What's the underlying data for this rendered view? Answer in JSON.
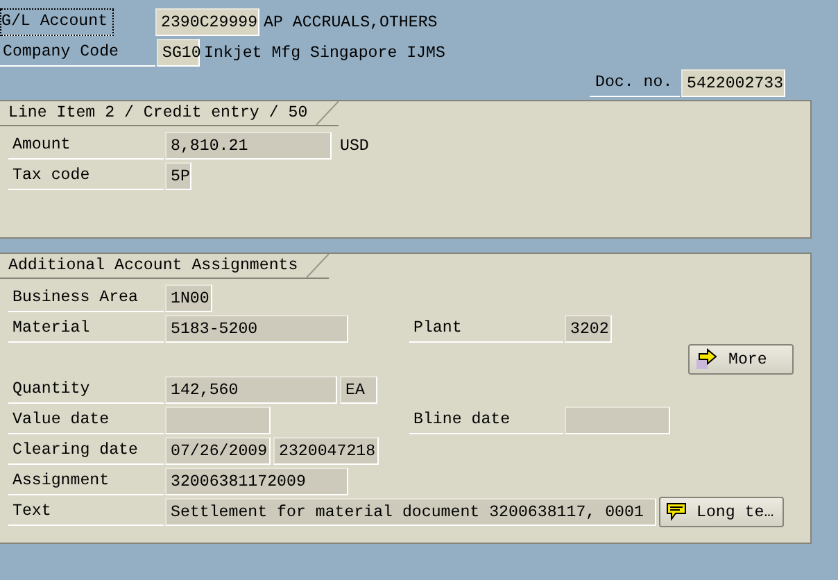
{
  "header": {
    "gl_account": {
      "label": "G/L Account",
      "value": "2390C29999",
      "description": "AP ACCRUALS,OTHERS",
      "focused": true
    },
    "company_code": {
      "label": "Company Code",
      "value": "SG10",
      "description": "Inkjet Mfg Singapore IJMS"
    },
    "doc_no": {
      "label": "Doc. no.",
      "value": "5422002733"
    }
  },
  "line_item": {
    "title": "Line Item 2 / Credit entry / 50",
    "amount": {
      "label": "Amount",
      "value": "8,810.21",
      "currency": "USD"
    },
    "tax_code": {
      "label": "Tax code",
      "value": "5P"
    }
  },
  "additional": {
    "title": "Additional Account Assignments",
    "business_area": {
      "label": "Business Area",
      "value": "1N00"
    },
    "material": {
      "label": "Material",
      "value": "5183-5200"
    },
    "plant": {
      "label": "Plant",
      "value": "3202"
    },
    "more_button": {
      "label": "More"
    },
    "quantity": {
      "label": "Quantity",
      "value": "142,560",
      "unit": "EA"
    },
    "value_date": {
      "label": "Value date"
    },
    "bline_date": {
      "label": "Bline date"
    },
    "clearing_date": {
      "label": "Clearing date",
      "value": "07/26/2009",
      "document": "2320047218"
    },
    "assignment": {
      "label": "Assignment",
      "value": "32006381172009"
    },
    "text": {
      "label": "Text",
      "value": "Settlement for material document 3200638117, 0001"
    },
    "long_text_button": {
      "label": "Long te…"
    }
  }
}
